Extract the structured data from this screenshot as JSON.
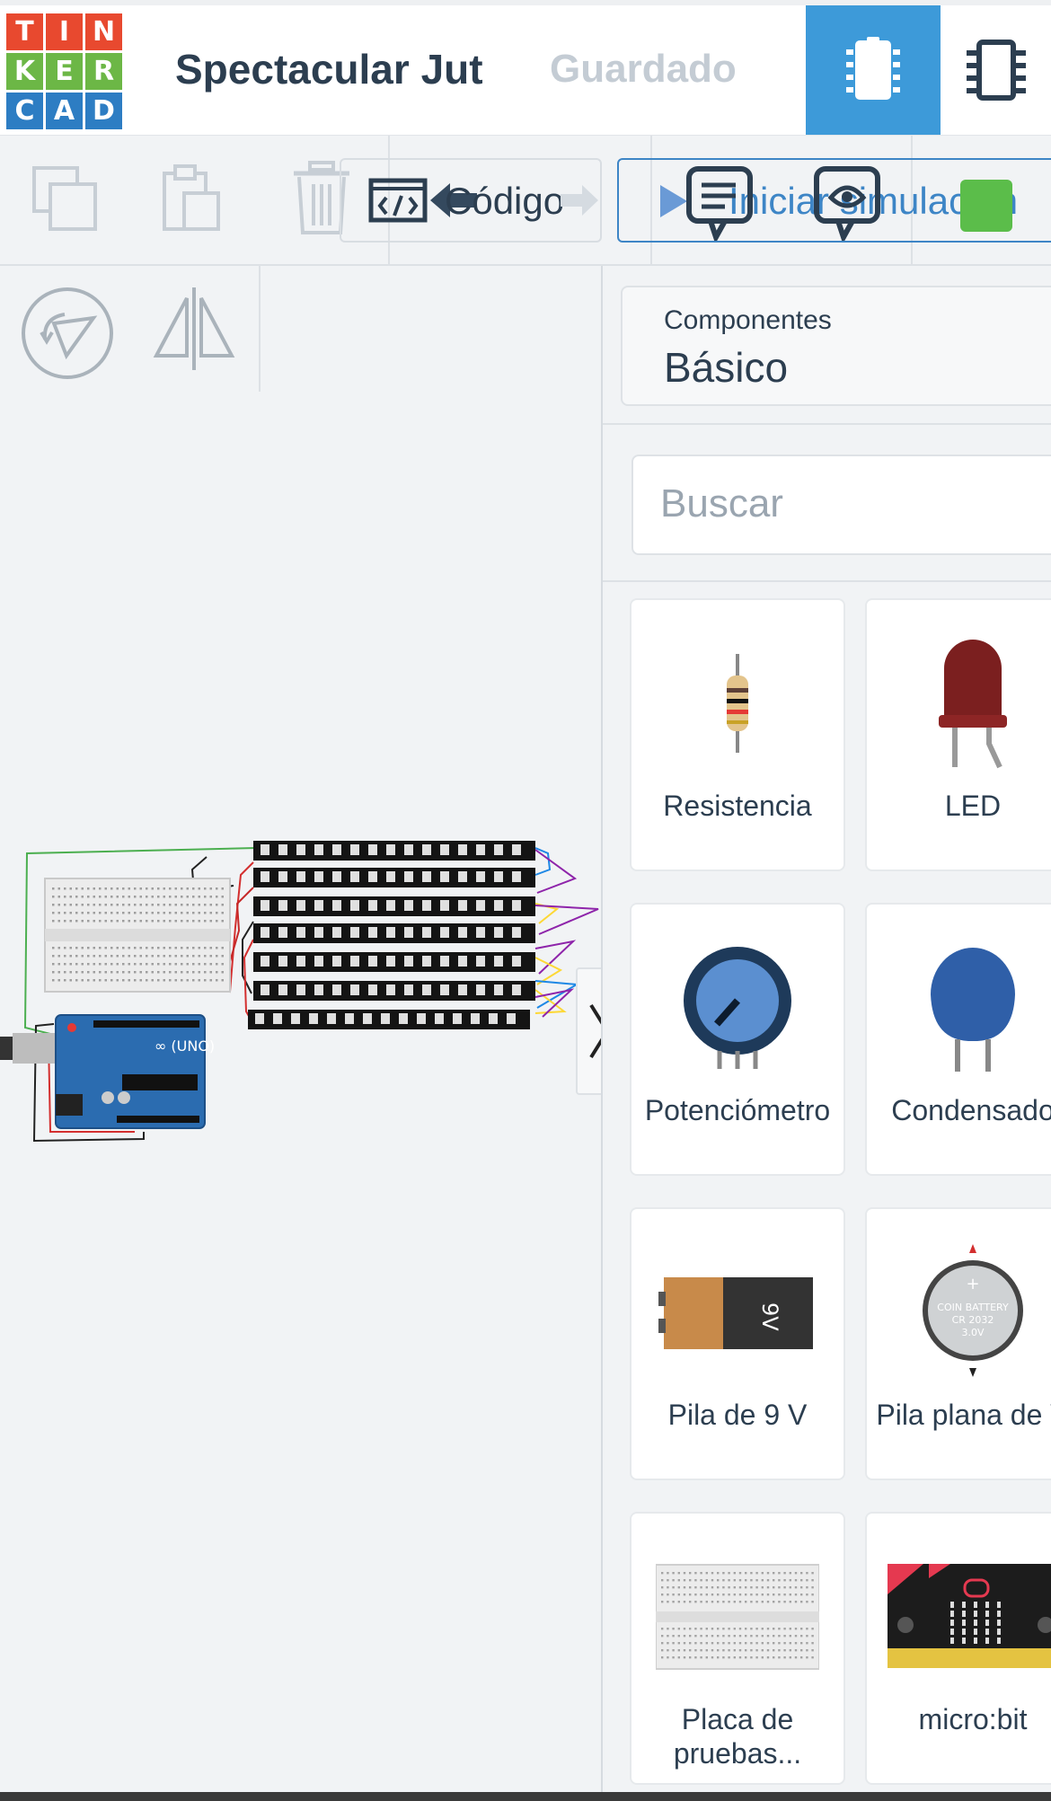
{
  "header": {
    "logo_letters": [
      "T",
      "I",
      "N",
      "K",
      "E",
      "R",
      "C",
      "A",
      "D"
    ],
    "logo_colors": [
      "#e8492f",
      "#e8492f",
      "#e8492f",
      "#6cb746",
      "#6cb746",
      "#6cb746",
      "#2d7dc3",
      "#2d7dc3",
      "#2d7dc3"
    ],
    "project_title": "Spectacular Jut",
    "save_status": "Guardado",
    "active_button_color": "#3d9ad9"
  },
  "toolbar": {
    "copy_icon": "copy-icon",
    "paste_icon": "paste-icon",
    "delete_icon": "trash-icon",
    "undo_icon": "undo-icon",
    "redo_icon": "redo-icon",
    "code_label": "Código",
    "simulate_label": "Iniciar simulación",
    "accent": "#3d85c6"
  },
  "panel": {
    "category_small": "Componentes",
    "category_selected": "Básico",
    "search_placeholder": "Buscar",
    "components": [
      {
        "label": "Resistencia",
        "icon": "resistor-icon"
      },
      {
        "label": "LED",
        "icon": "led-icon"
      },
      {
        "label": "Potenciómetro",
        "icon": "potentiometer-icon"
      },
      {
        "label": "Condensado",
        "icon": "capacitor-icon"
      },
      {
        "label": "Pila de 9 V",
        "icon": "battery-9v-icon"
      },
      {
        "label": "Pila plana de V",
        "icon": "coin-battery-icon"
      },
      {
        "label": "Placa de pruebas...",
        "icon": "breadboard-icon"
      },
      {
        "label": "micro:bit",
        "icon": "microbit-icon"
      }
    ]
  },
  "coin_battery": {
    "l1": "COIN BATTERY",
    "l2": "CR 2032",
    "l3": "3.0V"
  },
  "battery_label": "9V"
}
